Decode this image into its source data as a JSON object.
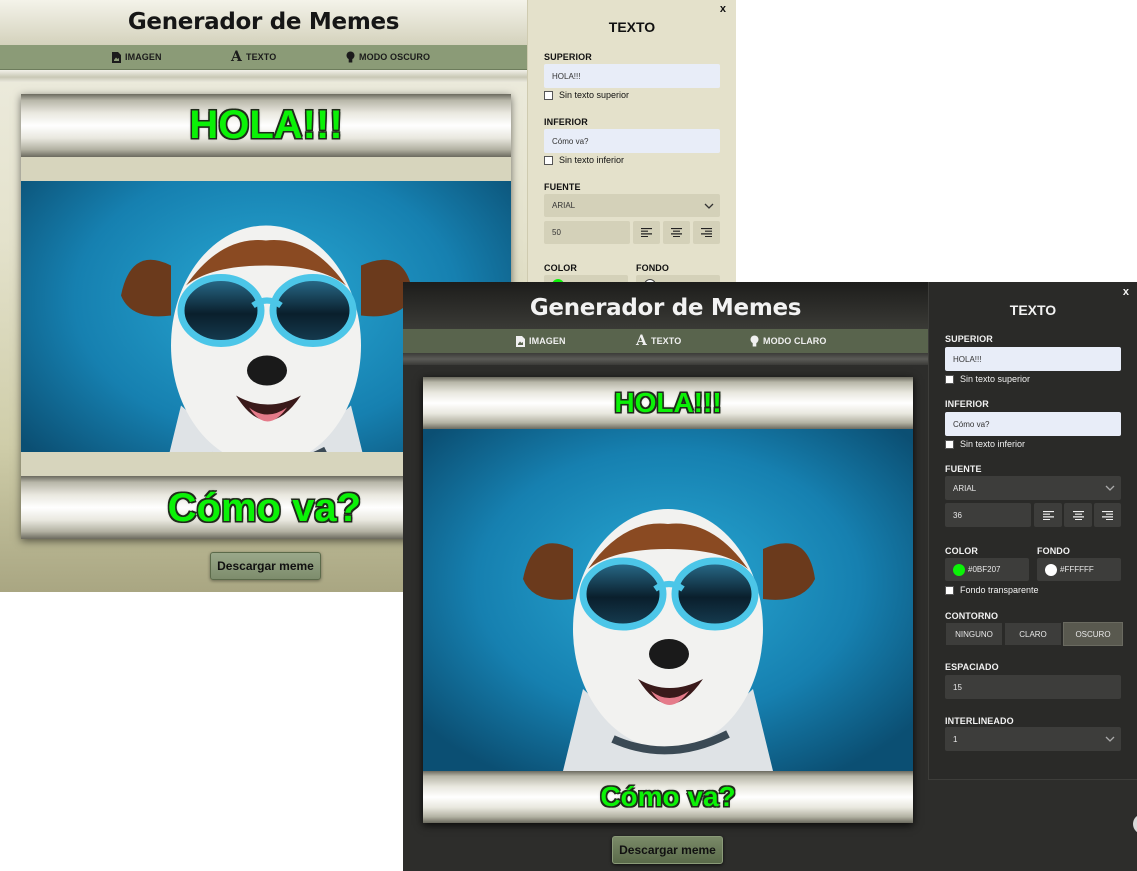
{
  "light": {
    "title": "Generador de Memes",
    "nav": [
      {
        "icon": "image-file-icon",
        "label": "IMAGEN"
      },
      {
        "icon": "text-a-icon",
        "label": "TEXTO"
      },
      {
        "icon": "lightbulb-icon",
        "label": "MODO OSCURO"
      }
    ],
    "meme": {
      "top_text": "HOLA!!!",
      "bottom_text": "Cómo va?"
    },
    "download_label": "Descargar meme",
    "panel": {
      "close": "x",
      "title": "TEXTO",
      "superior_label": "SUPERIOR",
      "superior_value": "HOLA!!!",
      "sin_superior": "Sin texto superior",
      "inferior_label": "INFERIOR",
      "inferior_value": "Cómo va?",
      "sin_inferior": "Sin texto inferior",
      "fuente_label": "FUENTE",
      "font_value": "ARIAL",
      "size_value": "50",
      "color_label": "COLOR",
      "fondo_label": "FONDO"
    }
  },
  "dark": {
    "title": "Generador de Memes",
    "nav": [
      {
        "icon": "image-file-icon",
        "label": "IMAGEN"
      },
      {
        "icon": "text-a-icon",
        "label": "TEXTO"
      },
      {
        "icon": "lightbulb-icon",
        "label": "MODO CLARO"
      }
    ],
    "meme": {
      "top_text": "HOLA!!!",
      "bottom_text": "Cómo va?"
    },
    "download_label": "Descargar meme",
    "panel": {
      "close": "x",
      "title": "TEXTO",
      "superior_label": "SUPERIOR",
      "superior_value": "HOLA!!!",
      "sin_superior": "Sin texto superior",
      "inferior_label": "INFERIOR",
      "inferior_value": "Cómo va?",
      "sin_inferior": "Sin texto inferior",
      "fuente_label": "FUENTE",
      "font_value": "ARIAL",
      "size_value": "36",
      "color_label": "COLOR",
      "color_value": "#0BF207",
      "fondo_label": "FONDO",
      "fondo_value": "#FFFFFF",
      "fondo_transparente": "Fondo transparente",
      "contorno_label": "CONTORNO",
      "contorno_options": [
        "NINGUNO",
        "CLARO",
        "OSCURO"
      ],
      "contorno_selected": "OSCURO",
      "espaciado_label": "ESPACIADO",
      "espaciado_value": "15",
      "interlineado_label": "INTERLINEADO",
      "interlineado_value": "1"
    }
  },
  "colors": {
    "meme_text": "#0BF207",
    "light_nav": "#8B9B77",
    "dark_nav": "#59644D",
    "dark_panel": "#2A2A28",
    "light_panel": "#E4E1CB",
    "input_blue": "#E8EDF8"
  }
}
